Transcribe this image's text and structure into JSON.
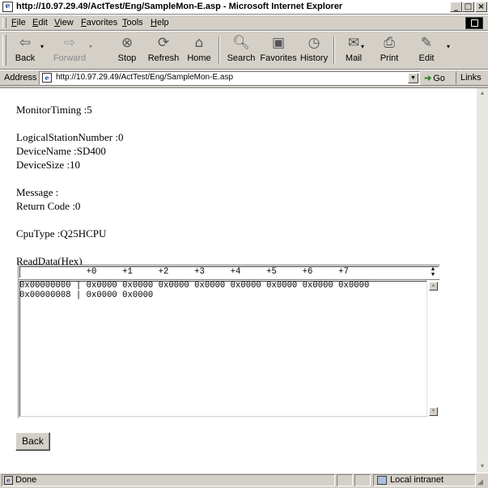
{
  "window": {
    "title": "http://10.97.29.49/ActTest/Eng/SampleMon-E.asp - Microsoft Internet Explorer",
    "app_icon": "ie-page-icon",
    "controls": [
      "minimize",
      "maximize",
      "close"
    ]
  },
  "menu": {
    "items": [
      "File",
      "Edit",
      "View",
      "Favorites",
      "Tools",
      "Help"
    ]
  },
  "toolbar": {
    "buttons": [
      {
        "label": "Back",
        "icon": "back-arrow",
        "glyph": "⇦",
        "enabled": true
      },
      {
        "label": "Forward",
        "icon": "forward-arrow",
        "glyph": "⇨",
        "enabled": false
      },
      {
        "label": "Stop",
        "icon": "stop",
        "glyph": "⊗",
        "enabled": true
      },
      {
        "label": "Refresh",
        "icon": "refresh",
        "glyph": "⟳",
        "enabled": true
      },
      {
        "label": "Home",
        "icon": "home",
        "glyph": "⌂",
        "enabled": true
      },
      {
        "label": "Search",
        "icon": "search",
        "glyph": "🔍︎",
        "enabled": true
      },
      {
        "label": "Favorites",
        "icon": "favorites",
        "glyph": "▣",
        "enabled": true
      },
      {
        "label": "History",
        "icon": "history",
        "glyph": "◷",
        "enabled": true
      },
      {
        "label": "Mail",
        "icon": "mail",
        "glyph": "✉",
        "enabled": true
      },
      {
        "label": "Print",
        "icon": "print",
        "glyph": "⎙",
        "enabled": true
      },
      {
        "label": "Edit",
        "icon": "edit",
        "glyph": "✎",
        "enabled": true
      }
    ]
  },
  "address": {
    "label": "Address",
    "url": "http://10.97.29.49/ActTest/Eng/SampleMon-E.asp",
    "go_label": "Go",
    "links_label": "Links"
  },
  "page": {
    "monitor_timing": "MonitorTiming :5",
    "logical_station": "LogicalStationNumber :0",
    "device_name": "DeviceName :SD400",
    "device_size": "DeviceSize :10",
    "message": "Message :",
    "return_code": "Return Code :0",
    "cpu_type": "CpuType :Q25HCPU",
    "read_data_label": "ReadData(Hex)",
    "hex_header": "             +0     +1     +2     +3     +4     +5     +6     +7",
    "hex_rows": [
      "0x00000000 | 0x0000 0x0000 0x0000 0x0000 0x0000 0x0000 0x0000 0x0000",
      "0x00000008 | 0x0000 0x0000"
    ],
    "back_button": "Back"
  },
  "status": {
    "text": "Done",
    "zone": "Local intranet"
  },
  "colors": {
    "chrome": "#d4d0c8",
    "content_bg": "#ffffff"
  }
}
